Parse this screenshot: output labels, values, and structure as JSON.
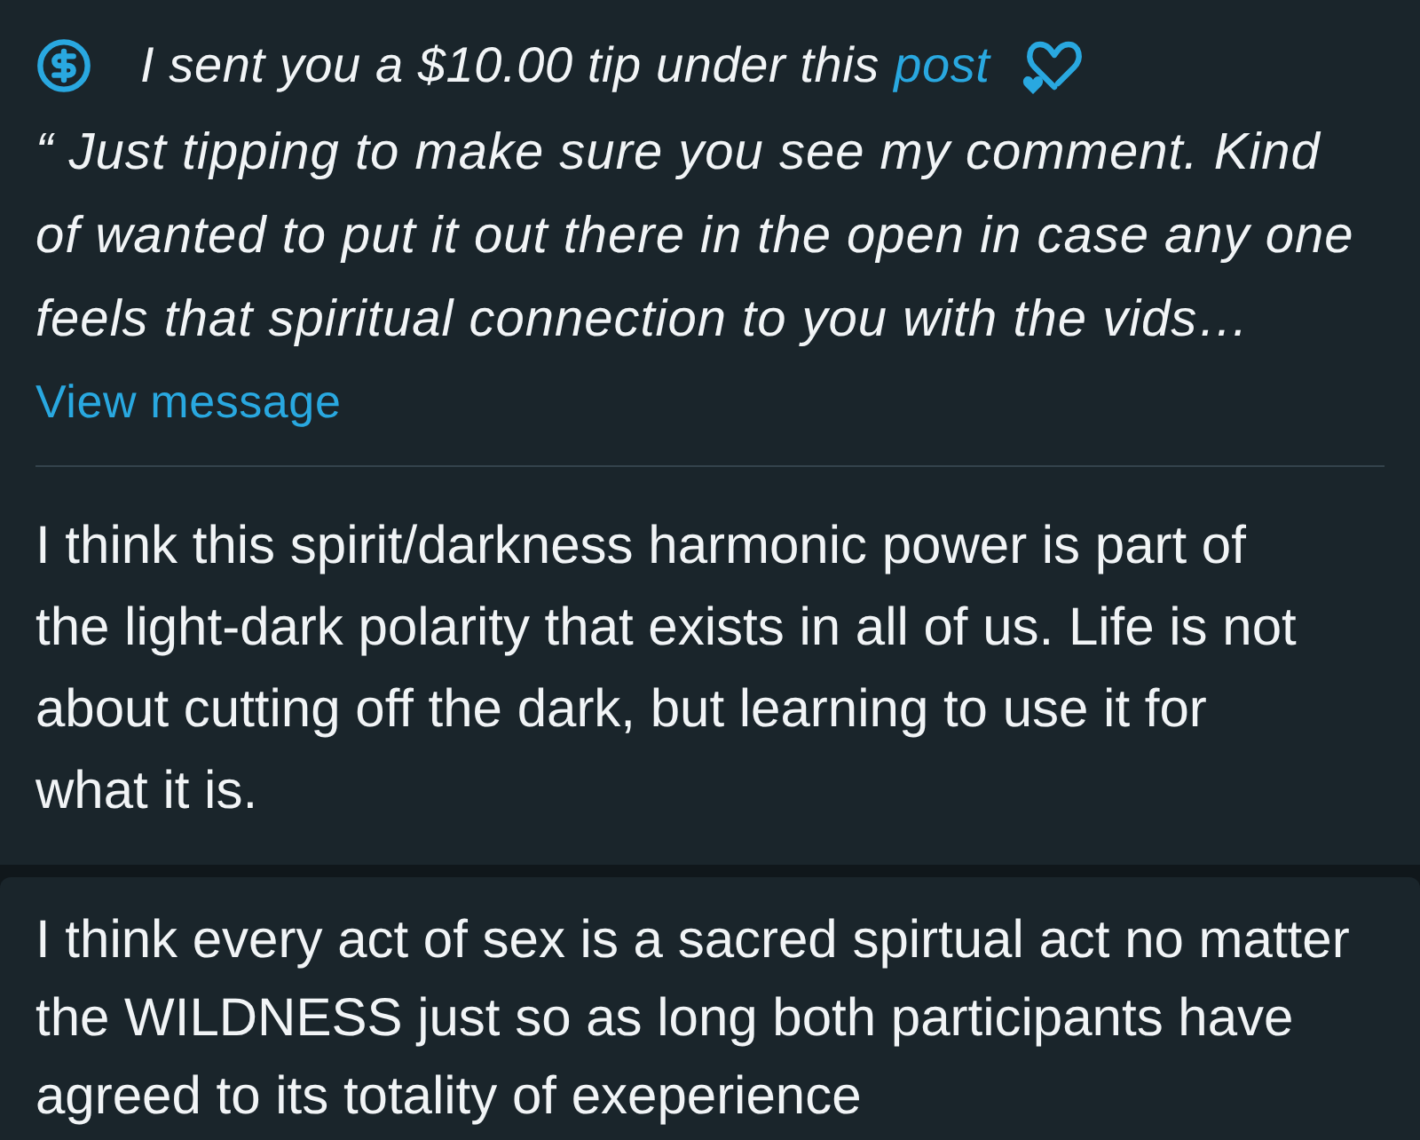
{
  "posts": [
    {
      "tip": {
        "message": "I sent you a $10.00 tip under this",
        "link": "post",
        "quote": "“ Just tipping to make sure you see my comment. Kind of wanted to put it out there in the open in case any one feels that spiritual connection to you with the vids…",
        "view_link": "View message"
      },
      "text": "I think this spirit/darkness harmonic power is part of the light-dark polarity that exists in all of us. Life is not about cutting off the dark, but learning to use it for what it is."
    },
    {
      "text": "I think every act of sex is a sacred spirtual act no matter the WILDNESS just so as long both participants have agreed to its totality of exeperience"
    }
  ]
}
